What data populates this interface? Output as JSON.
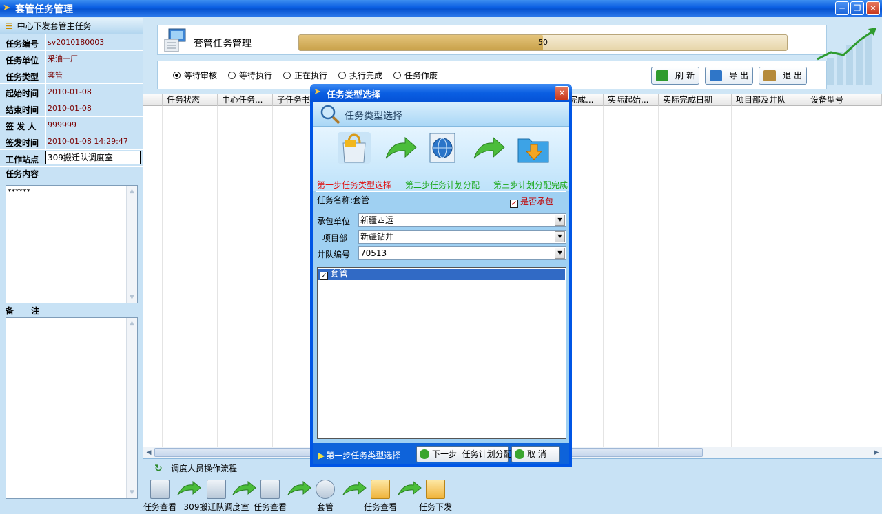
{
  "window": {
    "title": "套管任务管理"
  },
  "left_panel": {
    "header": "中心下发套管主任务",
    "fields": [
      {
        "label": "任务编号",
        "value": "sv2010180003"
      },
      {
        "label": "任务单位",
        "value": "采油一厂"
      },
      {
        "label": "任务类型",
        "value": "套管"
      },
      {
        "label": "起始时间",
        "value": "2010-01-08"
      },
      {
        "label": "结束时间",
        "value": "2010-01-08"
      },
      {
        "label": "签 发 人",
        "value": "999999"
      },
      {
        "label": "签发时间",
        "value": "2010-01-08 14:29:47"
      },
      {
        "label": "工作站点",
        "value": "309搬迁队调度室"
      }
    ],
    "content_label": "任务内容",
    "content_value": "******",
    "remark_label": "备      注"
  },
  "header": {
    "title": "套管任务管理",
    "progress_value": 50,
    "progress_fraction": 0.5
  },
  "filters": {
    "options": [
      "等待审核",
      "等待执行",
      "正在执行",
      "执行完成",
      "任务作废"
    ],
    "selected": "等待审核"
  },
  "toolbar": {
    "refresh": "刷新",
    "export": "导出",
    "exit": "退出"
  },
  "grid": {
    "columns": [
      "任务状态",
      "中心任务...",
      "子任务书",
      "完成...",
      "实际起始...",
      "实际完成日期",
      "项目部及井队",
      "设备型号"
    ]
  },
  "flow": {
    "title": "调度人员操作流程",
    "steps": [
      "任务查看",
      "309搬迁队调度室",
      "任务查看",
      "套管",
      "任务查看",
      "任务下发"
    ]
  },
  "dialog": {
    "title": "任务类型选择",
    "subtitle": "任务类型选择",
    "steps": [
      "第一步任务类型选择",
      "第二步任务计划分配",
      "第三步计划分配完成"
    ],
    "task_name_label": "任务名称:",
    "task_name_value": "套管",
    "contract_checkbox_label": "是否承包",
    "contract_checked": true,
    "contract_unit_label": "承包单位",
    "contract_unit_value": "新疆四运",
    "project_label": "项目部",
    "project_value": "新疆钻井",
    "team_label": "井队编号",
    "team_value": "70513",
    "list_items": [
      {
        "label": "套管",
        "checked": true
      }
    ],
    "footer_status": "第一步任务类型选择",
    "next_button": "下一步  任务计划分配",
    "cancel_button": "取 消"
  },
  "colors": {
    "title_bar": "#0a5ee2",
    "panel": "#c8e2f5",
    "step_active": "#e01010",
    "step_next": "#1aa81a",
    "accent_bar": "#c9a24a"
  }
}
